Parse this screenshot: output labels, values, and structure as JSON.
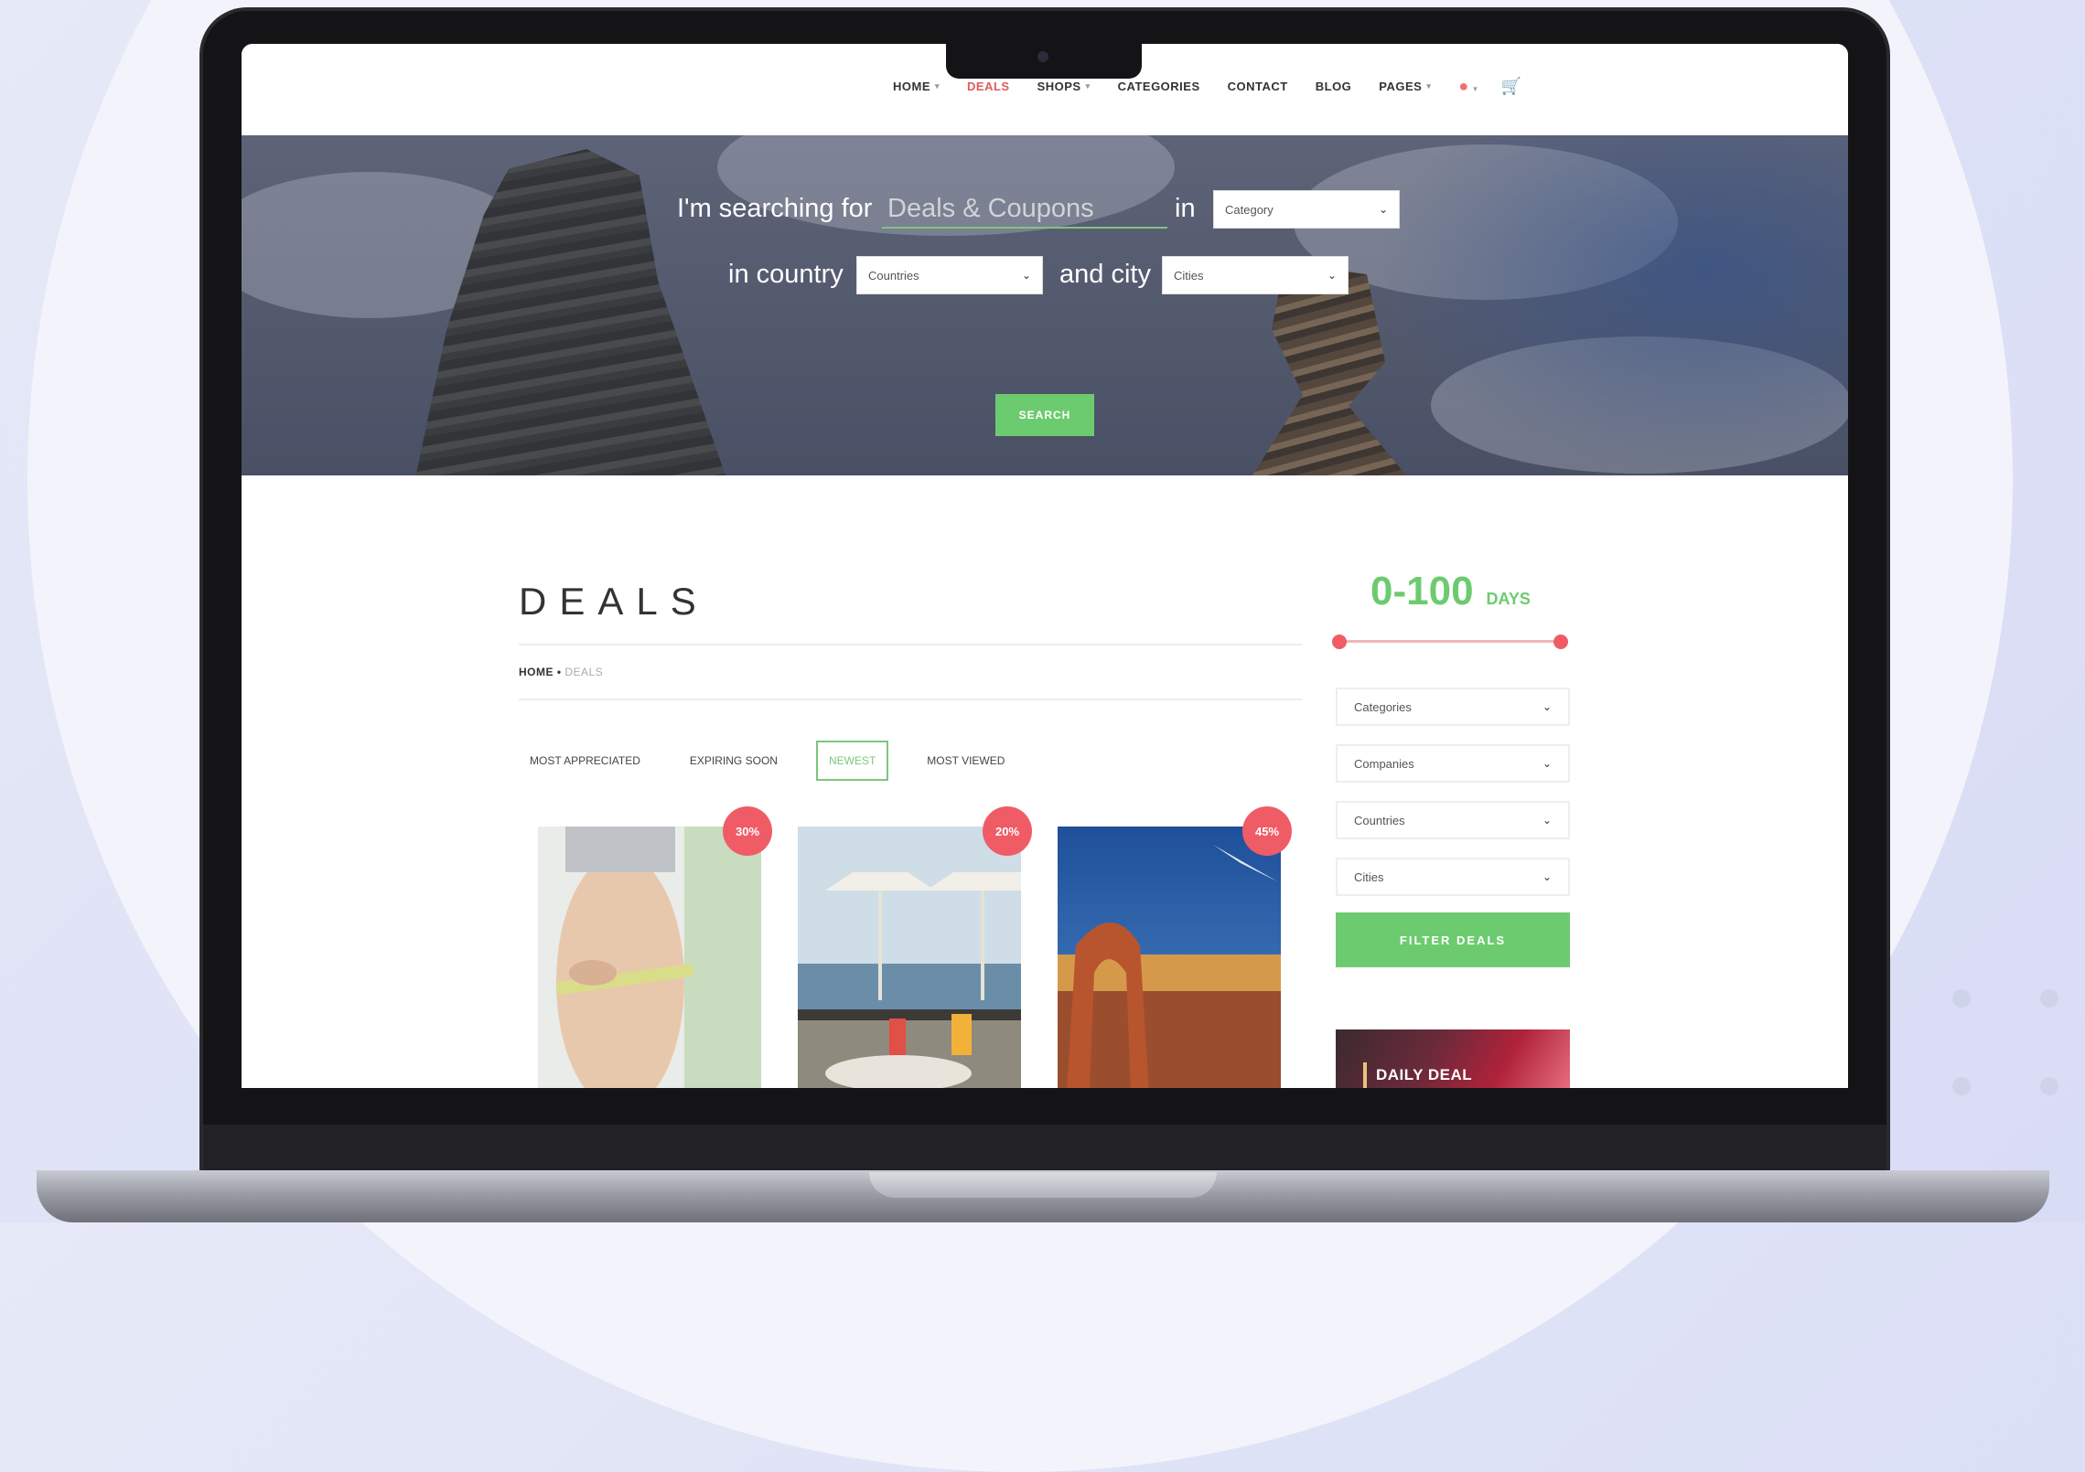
{
  "nav": {
    "items": [
      {
        "label": "HOME",
        "caret": true,
        "active": false
      },
      {
        "label": "DEALS",
        "caret": false,
        "active": true
      },
      {
        "label": "SHOPS",
        "caret": true,
        "active": false
      },
      {
        "label": "CATEGORIES",
        "caret": false,
        "active": false
      },
      {
        "label": "CONTACT",
        "caret": false,
        "active": false
      },
      {
        "label": "BLOG",
        "caret": false,
        "active": false
      },
      {
        "label": "PAGES",
        "caret": true,
        "active": false
      }
    ],
    "user_icon": "user-icon",
    "cart_icon": "cart-icon"
  },
  "hero": {
    "searching_for": "I'm searching for",
    "search_placeholder": "Deals & Coupons",
    "in_label": "in",
    "category_select": "Category",
    "country_label": "in country",
    "countries_select": "Countries",
    "city_label": "and city",
    "cities_select": "Cities",
    "search_button": "SEARCH"
  },
  "page": {
    "title": "DEALS",
    "breadcrumb_home": "HOME",
    "breadcrumb_sep": "•",
    "breadcrumb_current": "DEALS"
  },
  "tabs": [
    {
      "label": "MOST APPRECIATED",
      "active": false
    },
    {
      "label": "EXPIRING SOON",
      "active": false
    },
    {
      "label": "NEWEST",
      "active": true
    },
    {
      "label": "MOST VIEWED",
      "active": false
    }
  ],
  "cards": [
    {
      "discount": "30%",
      "image": "fitness-waist-measure"
    },
    {
      "discount": "20%",
      "image": "beach-resort-drinks"
    },
    {
      "discount": "45%",
      "image": "desert-arch"
    }
  ],
  "sidebar": {
    "days_value": "0-100",
    "days_unit": "DAYS",
    "range_min": 0,
    "range_max": 100,
    "selects": [
      "Categories",
      "Companies",
      "Countries",
      "Cities"
    ],
    "filter_button": "FILTER DEALS",
    "daily_deal_label": "DAILY DEAL"
  },
  "colors": {
    "accent_green": "#6dcb6f",
    "accent_red": "#ef5c66"
  }
}
